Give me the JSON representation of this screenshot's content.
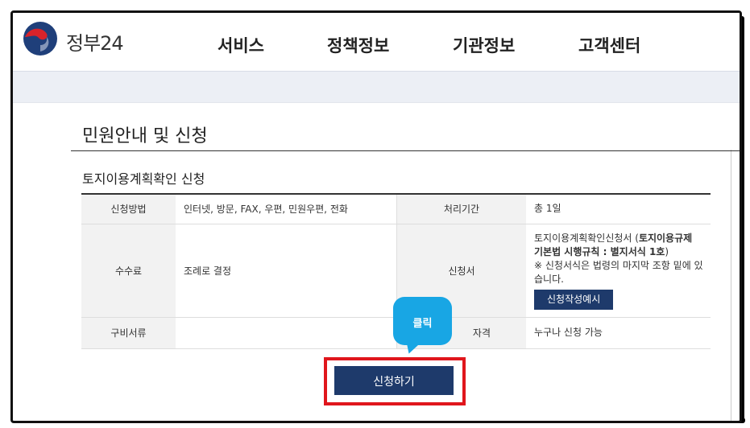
{
  "header": {
    "logo_text": "정부24",
    "nav": [
      "서비스",
      "정책정보",
      "기관정보",
      "고객센터"
    ]
  },
  "main": {
    "page_title": "민원안내 및 신청",
    "service_title": "토지이용계획확인 신청",
    "rows": {
      "method_label": "신청방법",
      "method_value": "인터넷, 방문, FAX, 우편, 민원우편, 전화",
      "period_label": "처리기간",
      "period_value": "총 1일",
      "fee_label": "수수료",
      "fee_value": "조례로 결정",
      "form_label": "신청서",
      "form_value_prefix": "토지이용계획확인신청서 (",
      "form_value_bold": "토지이용규제 기본법 시행규칙 : 별지서식 1호",
      "form_value_suffix": ")",
      "form_note": "※ 신청서식은 법령의 마지막 조항 밑에 있습니다.",
      "form_example_button": "신청작성예시",
      "docs_label": "구비서류",
      "docs_value": "",
      "qualification_label_visible": "자격",
      "qualification_value": "누구나 신청 가능"
    },
    "apply_button": "신청하기",
    "callout_text": "클릭"
  },
  "colors": {
    "primary_navy": "#1e3a6b",
    "highlight_red": "#e0161c",
    "callout_blue": "#18a6e4"
  }
}
